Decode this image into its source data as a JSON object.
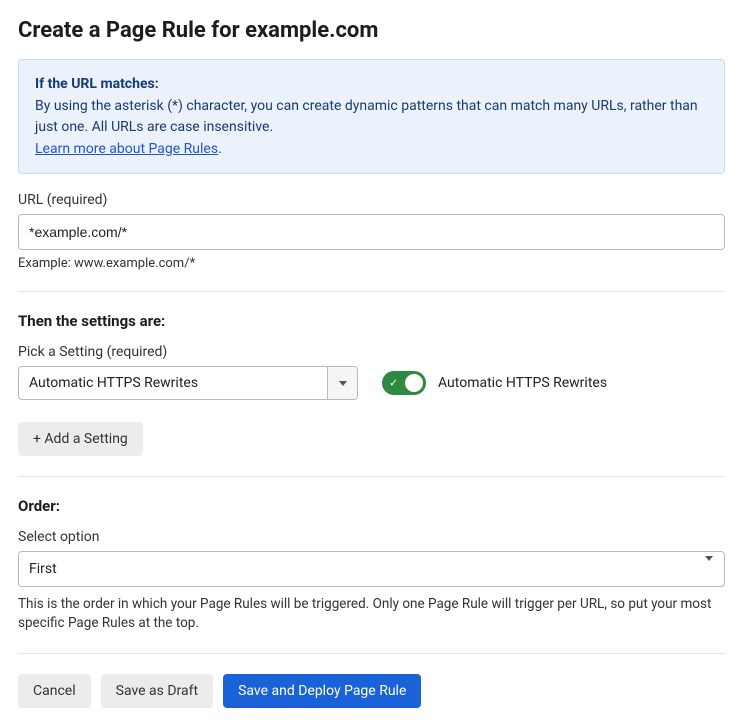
{
  "title": "Create a Page Rule for example.com",
  "banner": {
    "heading": "If the URL matches:",
    "body": "By using the asterisk (*) character, you can create dynamic patterns that can match many URLs, rather than just one. All URLs are case insensitive.",
    "link_text": "Learn more about Page Rules",
    "period": "."
  },
  "url_section": {
    "label": "URL (required)",
    "value": "*example.com/*",
    "example": "Example: www.example.com/*"
  },
  "settings_section": {
    "heading": "Then the settings are:",
    "picker_label": "Pick a Setting (required)",
    "selected_setting": "Automatic HTTPS Rewrites",
    "toggle_label": "Automatic HTTPS Rewrites",
    "toggle_on": true,
    "add_button": "+ Add a Setting"
  },
  "order_section": {
    "heading": "Order:",
    "select_label": "Select option",
    "selected": "First",
    "help": "This is the order in which your Page Rules will be triggered. Only one Page Rule will trigger per URL, so put your most specific Page Rules at the top."
  },
  "actions": {
    "cancel": "Cancel",
    "draft": "Save as Draft",
    "deploy": "Save and Deploy Page Rule"
  }
}
